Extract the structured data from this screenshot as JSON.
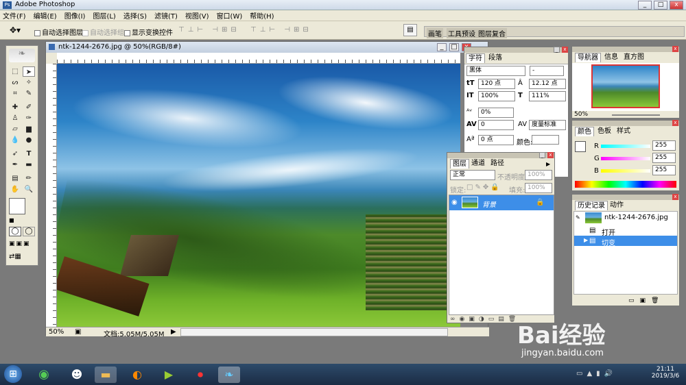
{
  "app": {
    "title": "Adobe Photoshop",
    "min": "_",
    "max": "□",
    "close": "x"
  },
  "menu": [
    "文件(F)",
    "编辑(E)",
    "图像(I)",
    "图层(L)",
    "选择(S)",
    "滤镜(T)",
    "视图(V)",
    "窗口(W)",
    "帮助(H)"
  ],
  "options": {
    "auto_select_layer": "自动选择图层",
    "auto_select_group": "自动选择组",
    "show_transform": "显示变换控件"
  },
  "palette_well": [
    "画笔",
    "工具预设",
    "图层复合"
  ],
  "document": {
    "title": "ntk-1244-2676.jpg @ 50%(RGB/8#)",
    "zoom": "50%",
    "doc_info": "文档:5.05M/5.05M"
  },
  "character": {
    "tabs": [
      "字符",
      "段落"
    ],
    "font": "黑体",
    "style": "-",
    "size": "120 点",
    "leading": "12.12 点",
    "vscale": "100%",
    "hscale": "111%",
    "tracking": "0%",
    "kerning": "0",
    "kern_mode": "度量标准",
    "baseline": "0 点",
    "color_label": "颜色:"
  },
  "layers": {
    "tabs": [
      "图层",
      "通道",
      "路径"
    ],
    "blend": "正常",
    "opacity_label": "不透明度:",
    "opacity": "100%",
    "lock_label": "锁定:",
    "fill_label": "填充:",
    "fill": "100%",
    "layer_name": "背景"
  },
  "navigator": {
    "tabs": [
      "导航器",
      "信息",
      "直方图"
    ],
    "zoom": "50%"
  },
  "color": {
    "tabs": [
      "颜色",
      "色板",
      "样式"
    ],
    "r_label": "R",
    "g_label": "G",
    "b_label": "B",
    "r": "255",
    "g": "255",
    "b": "255"
  },
  "history": {
    "tabs": [
      "历史记录",
      "动作"
    ],
    "snapshot": "ntk-1244-2676.jpg",
    "items": [
      "打开",
      "切变"
    ]
  },
  "taskbar": {
    "time": "21:11",
    "date": "2019/3/6"
  },
  "watermark": {
    "brand": "Bai经验",
    "url": "jingyan.baidu.com"
  }
}
